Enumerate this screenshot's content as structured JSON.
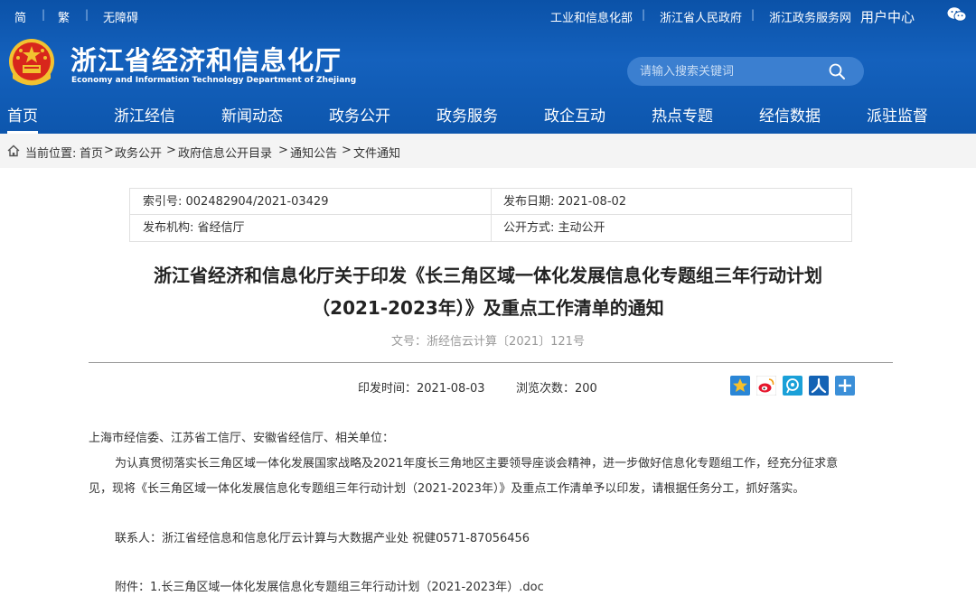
{
  "topbar": {
    "simplified": "简",
    "traditional": "繁",
    "accessibility": "无障碍",
    "links": [
      "工业和信息化部",
      "浙江省人民政府",
      "浙江政务服务网"
    ],
    "user_center": "用户中心"
  },
  "logo": {
    "name_cn": "浙江省经济和信息化厅",
    "name_en": "Economy and Information Technology Department of Zhejiang"
  },
  "search": {
    "placeholder": "请输入搜索关键词"
  },
  "nav": [
    "首页",
    "浙江经信",
    "新闻动态",
    "政务公开",
    "政务服务",
    "政企互动",
    "热点专题",
    "经信数据",
    "派驻监督"
  ],
  "breadcrumb": {
    "label": "当前位置:",
    "items": [
      "首页",
      "政务公开",
      "政府信息公开目录",
      "通知公告",
      "文件通知"
    ]
  },
  "meta": {
    "index_no": "索引号: 002482904/2021-03429",
    "publish_date": "发布日期: 2021-08-02",
    "issuer": "发布机构: 省经信厅",
    "disclosure": "公开方式: 主动公开"
  },
  "article": {
    "title_line1": "浙江省经济和信息化厅关于印发《长三角区域一体化发展信息化专题组三年行动计划",
    "title_line2": "（2021-2023年）》及重点工作清单的通知",
    "doc_number": "文号：浙经信云计算〔2021〕121号",
    "issue_time": "印发时间：2021-08-03",
    "views": "浏览次数：200",
    "recipients": "上海市经信委、江苏省工信厅、安徽省经信厅、相关单位：",
    "body_line1": "为认真贯彻落实长三角区域一体化发展国家战略及2021年度长三角地区主要领导座谈会精神，进一步做好信息化专题组工作，经充分征求意",
    "body_line2": "见，现将《长三角区域一体化发展信息化专题组三年行动计划（2021-2023年）》及重点工作清单予以印发，请根据任务分工，抓好落实。",
    "contact": "联系人：浙江省经信息和信息化厅云计算与大数据产业处  祝健0571-87056456",
    "attachment": "附件：1.长三角区域一体化发展信息化专题组三年行动计划（2021-2023年）.doc"
  },
  "colors": {
    "header_blue": "#0b52a8",
    "search_bg": "#3b7fd0",
    "emblem_red": "#d8261c",
    "gold": "#f2c230"
  }
}
